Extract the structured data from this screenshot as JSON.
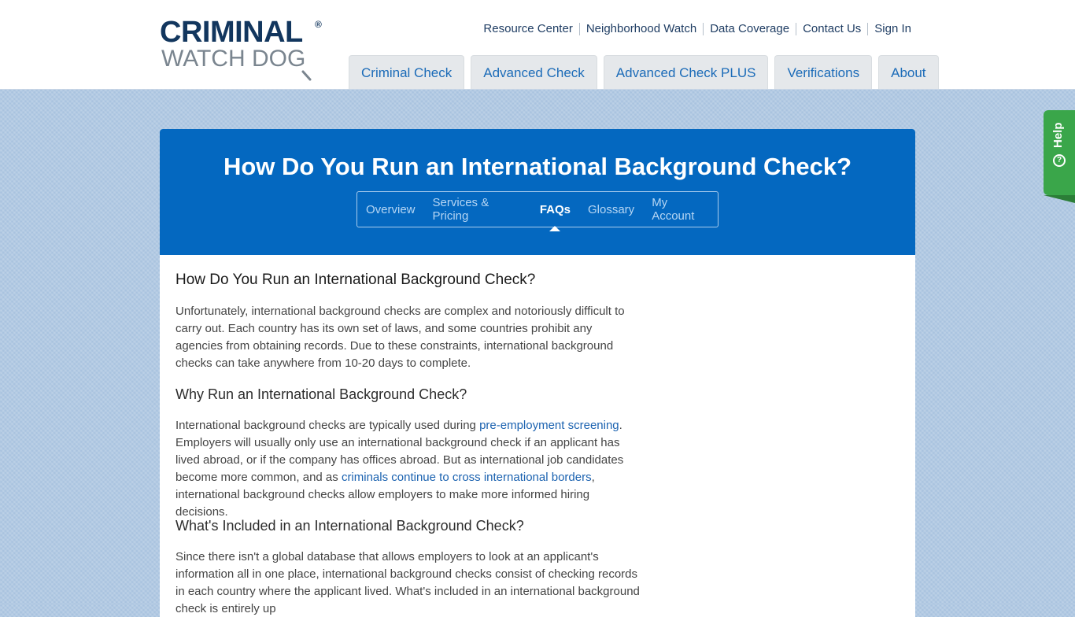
{
  "brand": {
    "line1": "CRIMINAL",
    "line2": "WATCH DOG",
    "registered": "®",
    "colors": {
      "navy": "#12365e",
      "gray": "#7a858f",
      "blue": "#0468c0",
      "green": "#3aa64a"
    }
  },
  "utility_nav": [
    {
      "label": "Resource Center"
    },
    {
      "label": "Neighborhood Watch"
    },
    {
      "label": "Data Coverage"
    },
    {
      "label": "Contact Us"
    },
    {
      "label": "Sign In"
    }
  ],
  "main_nav": [
    {
      "label": "Criminal Check"
    },
    {
      "label": "Advanced Check"
    },
    {
      "label": "Advanced Check PLUS"
    },
    {
      "label": "Verifications"
    },
    {
      "label": "About"
    }
  ],
  "help": {
    "label": "Help",
    "icon": "question-circle-icon"
  },
  "hero": {
    "title": "How Do You Run an International Background Check?",
    "subnav": [
      {
        "label": "Overview"
      },
      {
        "label": "Services & Pricing"
      },
      {
        "label": "FAQs",
        "active": true
      },
      {
        "label": "Glossary"
      },
      {
        "label": "My Account"
      }
    ]
  },
  "article": {
    "section1": {
      "heading": "How Do You Run an International Background Check?",
      "body": "Unfortunately, international background checks are complex and notoriously difficult to carry out. Each country has its own set of laws, and some countries prohibit any agencies from obtaining records. Due to these constraints, international background checks can take anywhere from 10-20 days to complete."
    },
    "section2": {
      "heading": "Why Run an International Background Check?",
      "body_before_link1": "International background checks are typically used during ",
      "link1": "pre-employment screening",
      "body_between": ". Employers will usually only use an international background check if an applicant has lived abroad, or if the company has offices abroad. But as international job candidates become more common, and as ",
      "link2": "criminals continue to cross international borders",
      "body_after": ", international background checks allow employers to make more informed hiring decisions."
    },
    "section3": {
      "heading": "What's Included in an International Background Check?",
      "body": "Since there isn't a global database that allows employers to look at an applicant's information all in one place, international background checks consist of checking records in each country where the applicant lived. What's included in an international background check is entirely up"
    }
  }
}
